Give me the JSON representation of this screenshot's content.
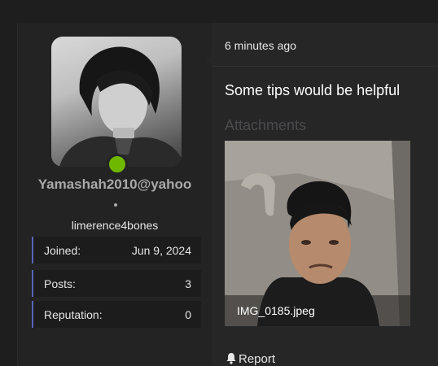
{
  "user": {
    "username": "Yamashah2010@yahoo",
    "title": "limerence4bones",
    "status": "online",
    "stats": [
      {
        "key": "Joined:",
        "value": "Jun 9, 2024"
      },
      {
        "key": "Posts:",
        "value": "3"
      },
      {
        "key": "Reputation:",
        "value": "0"
      }
    ]
  },
  "message": {
    "time": "6 minutes ago",
    "text": "Some tips would be helpful",
    "attachments_heading": "Attachments",
    "attachment_name": "IMG_0185.jpeg",
    "report_label": "Report"
  },
  "colors": {
    "background": "#1e1e1f",
    "panel": "#262627",
    "accent": "#5a64b8",
    "online": "#6fb800"
  },
  "icons": [
    "bell-icon"
  ]
}
